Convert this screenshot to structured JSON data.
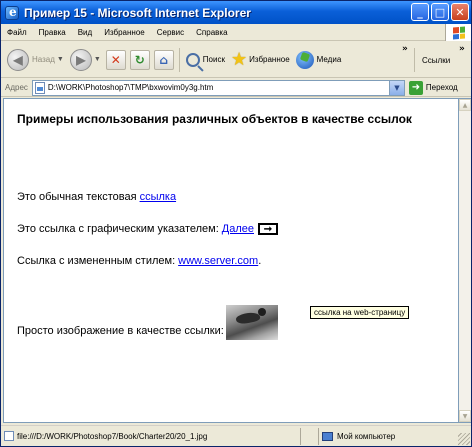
{
  "window": {
    "title": "Пример 15 - Microsoft Internet Explorer",
    "minimize": "_",
    "maximize": "□",
    "close": "✕"
  },
  "menu": {
    "items": [
      "Файл",
      "Правка",
      "Вид",
      "Избранное",
      "Сервис",
      "Справка"
    ]
  },
  "toolbar": {
    "back_label": "Назад",
    "search_label": "Поиск",
    "favorites_label": "Избранное",
    "media_label": "Медиа",
    "links_label": "Ссылки",
    "stop_glyph": "✕",
    "refresh_glyph": "↻",
    "home_glyph": "⌂",
    "overflow": "»"
  },
  "address": {
    "label": "Адрес",
    "value": "D:\\WORK\\Photoshop7\\TMP\\bxwovim0y3g.htm",
    "go_label": "Переход"
  },
  "content": {
    "heading": "Примеры использования различных объектов в качестве ссылок",
    "line1_text": "Это обычная текстовая",
    "line1_link": "ссылка",
    "line2_text": "Это ссылка с графическим указателем:",
    "line2_link": "Далее",
    "line2_arrow": "➞",
    "line3_text": "Ссылка с измененным стилем:",
    "line3_link": "www.server.com",
    "line3_suffix": ".",
    "line4_text": "Просто изображение в качестве ссылки:",
    "tooltip": "ссылка на web-страницу"
  },
  "status": {
    "url": "file:///D:/WORK/Photoshop7/Book/Charter20/20_1.jpg",
    "zone": "Мой компьютер"
  }
}
